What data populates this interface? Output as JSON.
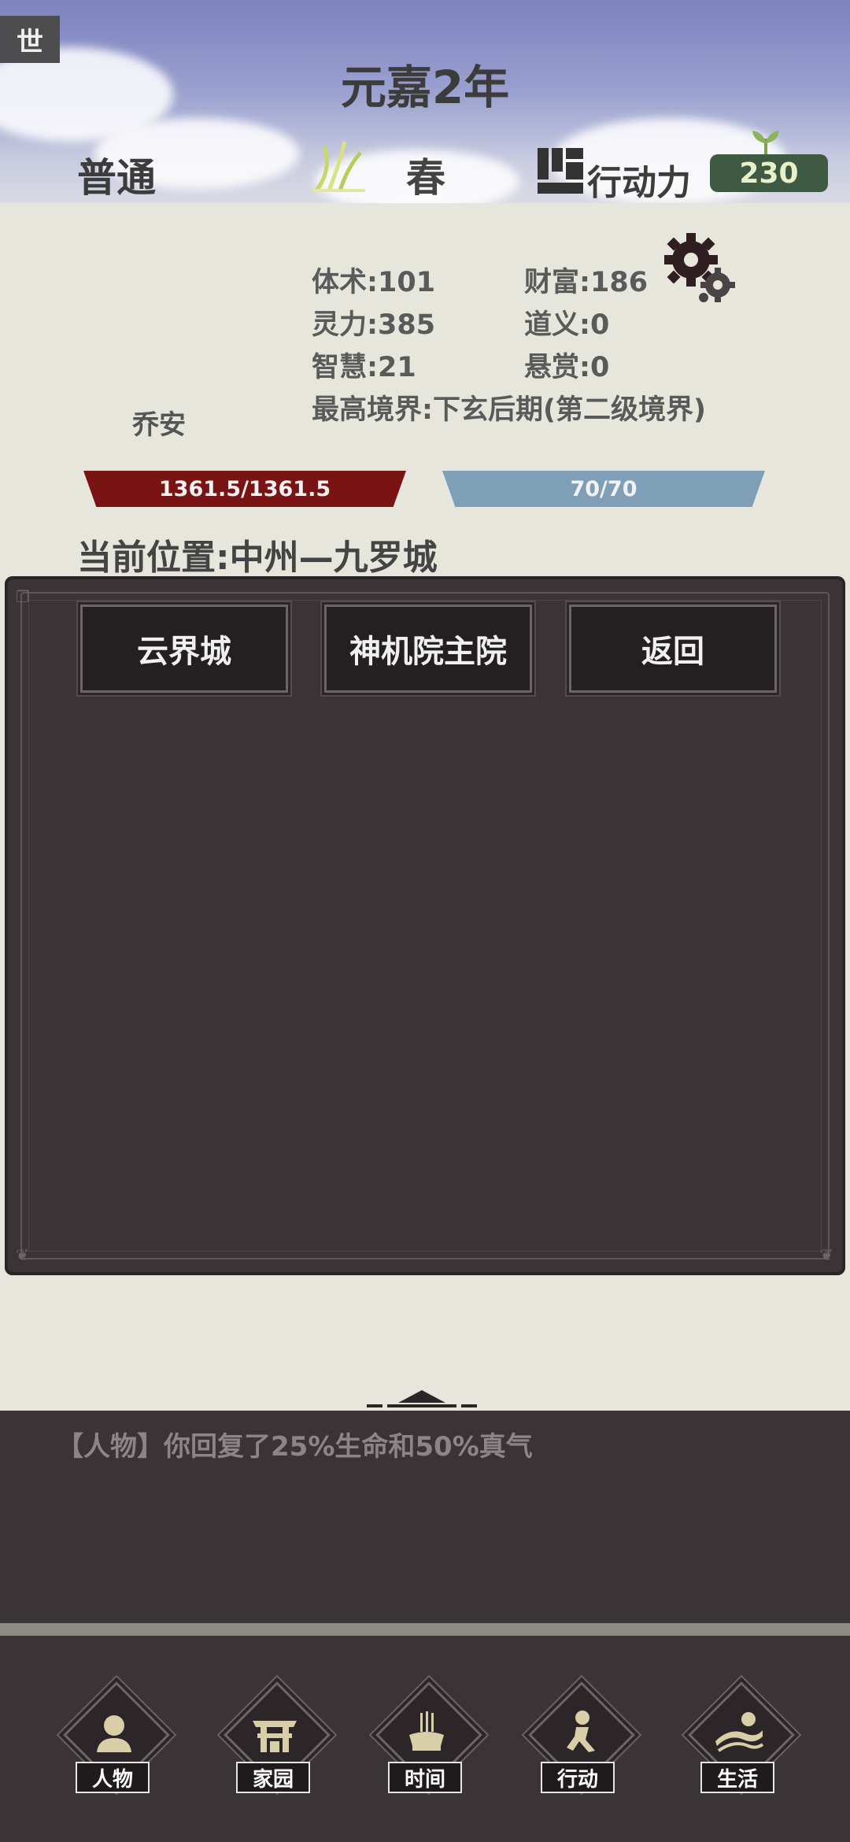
{
  "header": {
    "corner_tab": "世",
    "year": "元嘉2年",
    "difficulty": "普通",
    "season": "春",
    "action_label": "行动力",
    "action_points": "230"
  },
  "character": {
    "name": "乔安",
    "stats": {
      "body": "体术:101",
      "wealth": "财富:186",
      "spirit": "灵力:385",
      "righteousness": "道义:0",
      "wisdom": "智慧:21",
      "bounty": "悬赏:0",
      "realm": "最高境界:下玄后期(第二级境界)"
    },
    "hp": "1361.5/1361.5",
    "mp": "70/70"
  },
  "location": "当前位置:中州—九罗城",
  "destinations": [
    {
      "label": "云界城"
    },
    {
      "label": "神机院主院"
    },
    {
      "label": "返回"
    }
  ],
  "log": {
    "lines": [
      "【人物】你回复了25%生命和50%真气"
    ]
  },
  "nav": [
    {
      "label": "人物"
    },
    {
      "label": "家园"
    },
    {
      "label": "时间"
    },
    {
      "label": "行动"
    },
    {
      "label": "生活"
    }
  ],
  "colors": {
    "hp_bar": "#7a1414",
    "mp_bar": "#7f9fb6",
    "panel": "#3a3436",
    "energy_badge": "#3f5a42"
  }
}
